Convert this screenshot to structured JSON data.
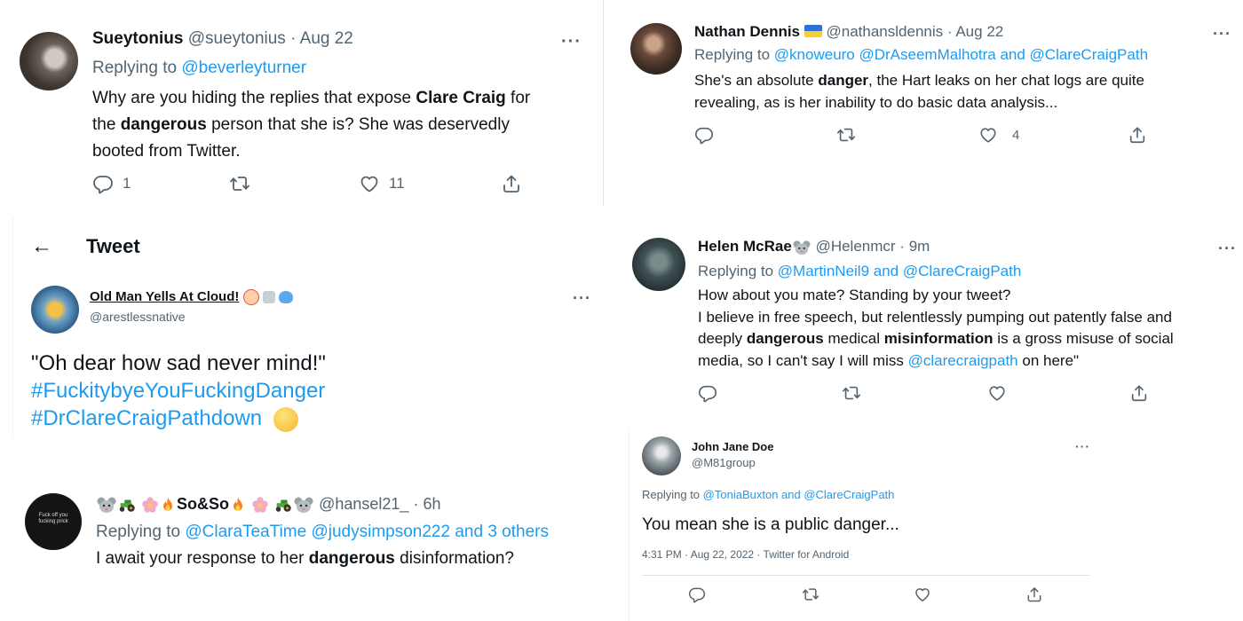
{
  "t1": {
    "name": "Sueytonius",
    "handle": "@sueytonius",
    "sep": "·",
    "date": "Aug 22",
    "replying_to_label": "Replying to",
    "replying_to": "@beverleyturner",
    "body_a": "Why are you hiding the replies that expose ",
    "body_b": "Clare Craig",
    "body_c": " for",
    "body_d": "the ",
    "body_e": "dangerous",
    "body_f": " person that she is? She was deservedly",
    "body_g": "booted from Twitter.",
    "replies": "1",
    "likes": "11",
    "more": "···"
  },
  "t2": {
    "name": "Nathan Dennis",
    "handle": "@nathansldennis",
    "sep": "·",
    "date": "Aug 22",
    "replying_to_label": "Replying to",
    "replying_to": "@knoweuro @DrAseemMalhotra and @ClareCraigPath",
    "body_a": "She's an absolute ",
    "body_b": "danger",
    "body_c": ", the Hart leaks on her chat logs are quite",
    "body_d": "revealing, as is her inability to do basic data analysis...",
    "likes": "4",
    "more": "···"
  },
  "t3": {
    "back_arrow": "←",
    "header": "Tweet",
    "name": "Old Man Yells At Cloud!",
    "handle": "@arestlessnative",
    "quote": "\"Oh dear how sad never mind!\"",
    "tag1": "#FuckitybyeYouFuckingDanger",
    "tag2": "#DrClareCraigPathdown",
    "more": "···"
  },
  "t4": {
    "name": "Helen McRae",
    "handle": "@Helenmcr",
    "sep": "·",
    "date": "9m",
    "replying_to_label": "Replying to",
    "replying_to": "@MartinNeil9 and @ClareCraigPath",
    "line1": "How about you mate?  Standing by your tweet?",
    "line2": "I believe in free speech, but relentlessly pumping out patently false and",
    "line3_a": "deeply ",
    "line3_b": "dangerous",
    "line3_c": " medical ",
    "line3_d": "misinformation",
    "line3_e": " is a gross misuse of social",
    "line4_a": "media, so I can't say I will miss ",
    "line4_b": "@clarecraigpath",
    "line4_c": " on here\"",
    "more": "···"
  },
  "t5": {
    "name": "So&So",
    "handle": "@hansel21_",
    "sep": "·",
    "date": "6h",
    "replying_to_label": "Replying to",
    "replying_to": "@ClaraTeaTime @judysimpson222 and 3 others",
    "body_a": "I await your response to her ",
    "body_b": "dangerous",
    "body_c": " disinformation?",
    "avatar_text": "Fuck off you fucking prick"
  },
  "t6": {
    "name": "John Jane Doe",
    "handle": "@M81group",
    "replying_to_label": "Replying to",
    "replying_to": "@ToniaBuxton and @ClareCraigPath",
    "body": "You mean  she is a public danger...",
    "timestamp": "4:31 PM · Aug 22, 2022 · Twitter for Android",
    "more": "···"
  },
  "colors": {
    "accent": "#1d9bf0",
    "text": "#0f1419",
    "secondary": "#536471"
  },
  "icons": [
    "reply-icon",
    "retweet-icon",
    "like-icon",
    "share-icon",
    "back-arrow-icon",
    "more-icon"
  ]
}
